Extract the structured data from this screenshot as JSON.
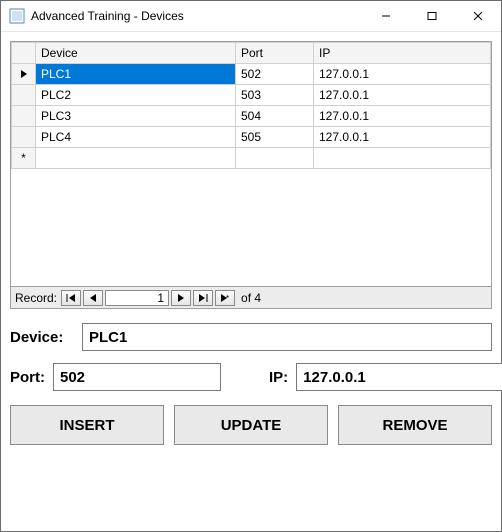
{
  "window": {
    "title": "Advanced Training - Devices"
  },
  "grid": {
    "headers": {
      "device": "Device",
      "port": "Port",
      "ip": "IP"
    },
    "rows": [
      {
        "device": "PLC1",
        "port": "502",
        "ip": "127.0.0.1"
      },
      {
        "device": "PLC2",
        "port": "503",
        "ip": "127.0.0.1"
      },
      {
        "device": "PLC3",
        "port": "504",
        "ip": "127.0.0.1"
      },
      {
        "device": "PLC4",
        "port": "505",
        "ip": "127.0.0.1"
      }
    ],
    "selected_index": 0
  },
  "recordnav": {
    "label": "Record:",
    "position": "1",
    "of_text": "of 4"
  },
  "form": {
    "labels": {
      "device": "Device:",
      "port": "Port:",
      "ip": "IP:"
    },
    "values": {
      "device": "PLC1",
      "port": "502",
      "ip": "127.0.0.1"
    }
  },
  "buttons": {
    "insert": "INSERT",
    "update": "UPDATE",
    "remove": "REMOVE"
  }
}
